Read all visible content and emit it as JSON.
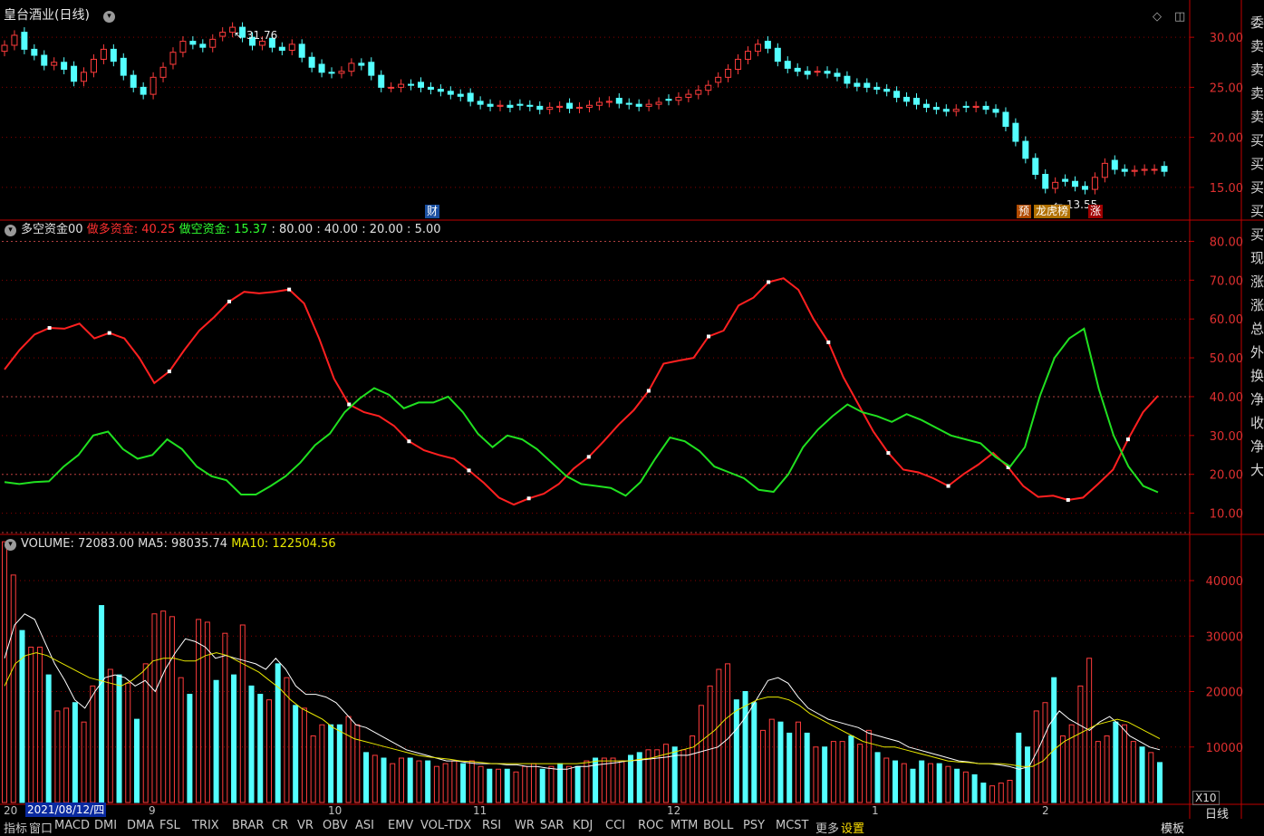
{
  "title": "皇台酒业(日线)",
  "colors": {
    "up": "#ff3c3c",
    "down": "#54ffff",
    "bull": "#ff2020",
    "bear": "#20e020",
    "ma5": "#ffffff",
    "ma10": "#e8e800",
    "grid": "#8a0000",
    "frame": "#c00000"
  },
  "price_panel": {
    "peak_label": "31.76",
    "low_label": "13.55",
    "markers": [
      "财",
      "预",
      "龙虎榜",
      "涨"
    ]
  },
  "indicator_panel": {
    "name": "多空资金00",
    "bull_label": "做多资金:",
    "bull_value": "40.25",
    "bear_label": "做空资金:",
    "bear_value": "15.37",
    "levels_text": ": 80.00 : 40.00 : 20.00 : 5.00"
  },
  "volume_panel": {
    "name": "VOLUME:",
    "value": "72083.00",
    "ma5_label": "MA5:",
    "ma5_value": "98035.74",
    "ma10_label": "MA10:",
    "ma10_value": "122504.56",
    "unit": "X10"
  },
  "x_axis": {
    "selected_date": "2021/08/12/四",
    "prefix": "20",
    "month_labels": [
      "9",
      "10",
      "11",
      "12",
      "1",
      "2"
    ]
  },
  "period_label": "日线",
  "bottom_tabs": [
    "指标",
    "窗口",
    "MACD",
    "DMI",
    "DMA",
    "FSL",
    "TRIX",
    "BRAR",
    "CR",
    "VR",
    "OBV",
    "ASI",
    "EMV",
    "VOL-TDX",
    "RSI",
    "WR",
    "SAR",
    "KDJ",
    "CCI",
    "ROC",
    "MTM",
    "BOLL",
    "PSY",
    "MCST",
    "更多",
    "设置"
  ],
  "right_tab": "模板",
  "side_panel_chars": [
    "委",
    "卖",
    "卖",
    "卖",
    "卖",
    "买",
    "买",
    "买",
    "买",
    "买",
    "现",
    "涨",
    "涨",
    "总",
    "外",
    "换",
    "净",
    "收",
    "净",
    "大"
  ],
  "chart_data": [
    {
      "type": "candlestick",
      "title": "皇台酒业(日线)",
      "ylim": [
        12,
        33
      ],
      "yticks": [
        15,
        20,
        25,
        30
      ],
      "close": [
        29.2,
        30.2,
        28.8,
        28.2,
        27.2,
        27.5,
        26.8,
        25.6,
        26.5,
        27.8,
        28.8,
        27.6,
        26.2,
        25.0,
        24.3,
        26.0,
        27.0,
        28.5,
        29.6,
        29.3,
        29.0,
        29.8,
        30.5,
        31.0,
        30.0,
        29.2,
        29.6,
        29.0,
        28.7,
        29.3,
        28.0,
        27.0,
        26.5,
        26.4,
        26.6,
        27.4,
        27.2,
        26.2,
        25.0,
        25.0,
        25.3,
        25.2,
        25.0,
        24.8,
        24.6,
        24.3,
        24.1,
        23.6,
        23.3,
        23.1,
        23.2,
        23.0,
        23.2,
        23.1,
        22.8,
        23.0,
        23.1,
        22.9,
        23.0,
        23.2,
        23.5,
        23.6,
        23.4,
        23.3,
        23.1,
        23.3,
        23.5,
        23.7,
        24.0,
        24.3,
        24.7,
        25.2,
        26.0,
        26.8,
        27.8,
        28.6,
        29.3,
        28.9,
        27.6,
        26.9,
        26.6,
        26.3,
        26.6,
        26.4,
        26.1,
        25.4,
        25.1,
        25.0,
        24.8,
        24.6,
        24.0,
        23.6,
        23.3,
        23.0,
        22.8,
        22.6,
        22.8,
        23.0,
        23.1,
        22.8,
        22.5,
        21.1,
        19.6,
        17.9,
        16.3,
        14.9,
        15.5,
        15.6,
        15.1,
        14.8,
        16.0,
        17.4,
        16.8,
        16.6,
        16.7,
        16.8,
        16.8,
        16.6
      ],
      "peak": 31.76,
      "low": 13.55
    },
    {
      "type": "line",
      "title": "多空资金00",
      "ylim": [
        5,
        85
      ],
      "yticks": [
        10,
        20,
        30,
        40,
        50,
        60,
        70,
        80
      ],
      "reference_lines": [
        80,
        40,
        20,
        5
      ],
      "series": [
        {
          "name": "做多资金",
          "values": [
            47.0,
            52.0,
            56.0,
            57.7,
            57.5,
            58.8,
            55.0,
            56.4,
            55.0,
            50.0,
            43.5,
            46.5,
            52.0,
            57.0,
            60.5,
            64.5,
            67.0,
            66.6,
            67.0,
            67.6,
            64.0,
            55.0,
            44.6,
            38.0,
            36.0,
            35.0,
            32.5,
            28.5,
            26.2,
            25.0,
            24.0,
            21.0,
            17.8,
            14.0,
            12.2,
            13.8,
            15.0,
            17.5,
            21.5,
            24.5,
            28.5,
            32.8,
            36.5,
            41.5,
            48.5,
            49.3,
            50.0,
            55.5,
            57.0,
            63.5,
            65.5,
            69.5,
            70.5,
            67.5,
            60.0,
            54.0,
            45.0,
            38.0,
            31.0,
            25.5,
            21.2,
            20.5,
            19.0,
            17.0,
            20.0,
            22.5,
            25.5,
            21.8,
            17.0,
            14.2,
            14.5,
            13.4,
            14.0,
            17.5,
            21.2,
            29.0,
            36.0,
            40.25
          ]
        },
        {
          "name": "做空资金",
          "values": [
            18.0,
            17.5,
            18.0,
            18.2,
            22.0,
            25.0,
            30.0,
            31.0,
            26.5,
            24.0,
            25.0,
            29.0,
            26.5,
            22.0,
            19.5,
            18.5,
            14.8,
            14.8,
            17.0,
            19.5,
            23.0,
            27.5,
            30.5,
            36.0,
            39.5,
            42.2,
            40.5,
            37.0,
            38.5,
            38.5,
            40.0,
            36.0,
            30.5,
            27.0,
            30.0,
            29.0,
            26.5,
            23.0,
            19.5,
            17.5,
            17.0,
            16.5,
            14.5,
            18.0,
            24.0,
            29.5,
            28.5,
            26.0,
            22.0,
            20.5,
            19.0,
            16.0,
            15.5,
            20.0,
            27.0,
            31.5,
            35.0,
            38.0,
            36.0,
            35.0,
            33.5,
            35.5,
            34.0,
            32.0,
            30.0,
            29.0,
            28.0,
            24.5,
            22.0,
            27.0,
            40.0,
            50.0,
            55.0,
            57.5,
            42.0,
            30.0,
            22.0,
            17.0,
            15.37
          ]
        }
      ]
    },
    {
      "type": "bar",
      "title": "VOLUME",
      "ylim": [
        0,
        48000
      ],
      "yticks": [
        10000,
        20000,
        30000,
        40000
      ],
      "values": [
        47000,
        41000,
        31000,
        28000,
        28000,
        23000,
        16500,
        17000,
        18000,
        14500,
        21000,
        35500,
        24000,
        23000,
        21500,
        15000,
        25000,
        34000,
        34500,
        33500,
        22500,
        19500,
        33000,
        32500,
        22000,
        30500,
        23000,
        32000,
        21000,
        19500,
        18500,
        25000,
        22500,
        17500,
        17000,
        12000,
        14000,
        14000,
        14000,
        15500,
        14000,
        9000,
        8500,
        8000,
        7000,
        8000,
        8000,
        7500,
        7500,
        6500,
        7000,
        7500,
        7000,
        7500,
        6500,
        6000,
        6000,
        6000,
        5500,
        6500,
        7000,
        6000,
        6500,
        7000,
        6500,
        6500,
        7500,
        8000,
        8000,
        8000,
        7500,
        8500,
        9000,
        9500,
        9500,
        10500,
        10000,
        9500,
        12000,
        17500,
        21000,
        24000,
        25000,
        18500,
        20000,
        18000,
        13000,
        15000,
        14500,
        12500,
        14500,
        12500,
        10000,
        10000,
        11000,
        11000,
        12000,
        10500,
        13000,
        9000,
        8000,
        7500,
        7000,
        6000,
        7500,
        7000,
        7000,
        6500,
        6000,
        5500,
        5000,
        3500,
        3000,
        3500,
        4000,
        12500,
        10000,
        16500,
        18000,
        22500,
        12000,
        14000,
        21000,
        26000,
        11000,
        12000,
        14500,
        14000,
        11000,
        10000,
        9000,
        7200
      ],
      "up_flags": [
        1,
        1,
        0,
        1,
        1,
        0,
        1,
        1,
        0,
        1,
        1,
        0,
        1,
        0,
        1,
        0,
        1,
        1,
        1,
        1,
        1,
        0,
        1,
        1,
        0,
        1,
        0,
        1,
        0,
        0,
        1,
        0,
        1,
        0,
        1,
        1,
        1,
        0,
        0,
        1,
        1,
        0,
        1,
        0,
        1,
        1,
        0,
        1,
        0,
        1,
        1,
        1,
        0,
        1,
        1,
        0,
        1,
        0,
        1,
        1,
        1,
        0,
        1,
        0,
        1,
        0,
        1,
        0,
        1,
        1,
        1,
        0,
        0,
        1,
        1,
        1,
        0,
        1,
        1,
        1,
        1,
        1,
        1,
        0,
        0,
        0,
        1,
        1,
        0,
        0,
        1,
        0,
        1,
        0,
        1,
        1,
        0,
        1,
        1,
        0,
        1,
        0,
        1,
        0,
        0,
        1,
        0,
        1,
        0,
        1,
        0,
        0,
        1,
        1,
        1,
        0,
        0,
        1,
        1,
        0,
        1,
        1,
        1,
        1,
        1,
        1,
        0,
        1,
        1,
        0,
        1,
        0
      ],
      "ma5": [
        26000,
        32000,
        34000,
        33000,
        29000,
        25000,
        22000,
        18500,
        17000,
        20000,
        22500,
        23000,
        22500,
        21000,
        22000,
        20000,
        24000,
        27000,
        29500,
        29000,
        28000,
        26000,
        26500,
        26000,
        25500,
        25000,
        24000,
        26000,
        24000,
        21000,
        19500,
        19500,
        19000,
        18000,
        16000,
        14000,
        13500,
        12500,
        11500,
        10500,
        9500,
        9000,
        8500,
        8000,
        7500,
        7500,
        7200,
        7000,
        7000,
        7000,
        6800,
        6800,
        6500,
        6500,
        6200,
        6000,
        6000,
        6500,
        6500,
        6800,
        7000,
        7200,
        7500,
        7600,
        7800,
        8000,
        8200,
        8500,
        8500,
        9000,
        9500,
        10000,
        11500,
        13500,
        16000,
        19000,
        22000,
        22500,
        21500,
        19000,
        17000,
        16000,
        15000,
        14500,
        14000,
        13500,
        12500,
        12000,
        11500,
        11000,
        10000,
        9500,
        9000,
        8500,
        8000,
        7500,
        7300,
        7000,
        7000,
        6800,
        6500,
        6000,
        6500,
        10000,
        14000,
        16500,
        15000,
        14000,
        13000,
        14500,
        15500,
        14000,
        12000,
        11000,
        10000,
        9500
      ],
      "ma10": [
        21000,
        25000,
        26500,
        27000,
        26500,
        25500,
        24500,
        23500,
        22500,
        22000,
        21500,
        21000,
        22000,
        23500,
        25500,
        26000,
        26000,
        25500,
        25500,
        26500,
        27000,
        26500,
        25500,
        24500,
        23500,
        22000,
        20500,
        18500,
        17000,
        16000,
        15000,
        13500,
        12500,
        11500,
        11000,
        10500,
        10000,
        9500,
        9000,
        8500,
        8200,
        8000,
        7800,
        7500,
        7400,
        7200,
        7000,
        7000,
        7000,
        7000,
        7000,
        7000,
        7000,
        7000,
        7000,
        7200,
        7500,
        7500,
        7500,
        7500,
        7800,
        8000,
        8500,
        9000,
        9500,
        10000,
        11500,
        13000,
        15000,
        16500,
        17500,
        18500,
        19000,
        19000,
        18500,
        17500,
        16000,
        15000,
        14000,
        13000,
        12000,
        11000,
        10500,
        10000,
        10000,
        9500,
        9000,
        8500,
        8000,
        7500,
        7300,
        7200,
        7000,
        7000,
        7000,
        6800,
        6500,
        6500,
        7500,
        9500,
        11000,
        12000,
        13000,
        14000,
        14500,
        15000,
        14500,
        13500,
        12500,
        11500
      ]
    }
  ]
}
